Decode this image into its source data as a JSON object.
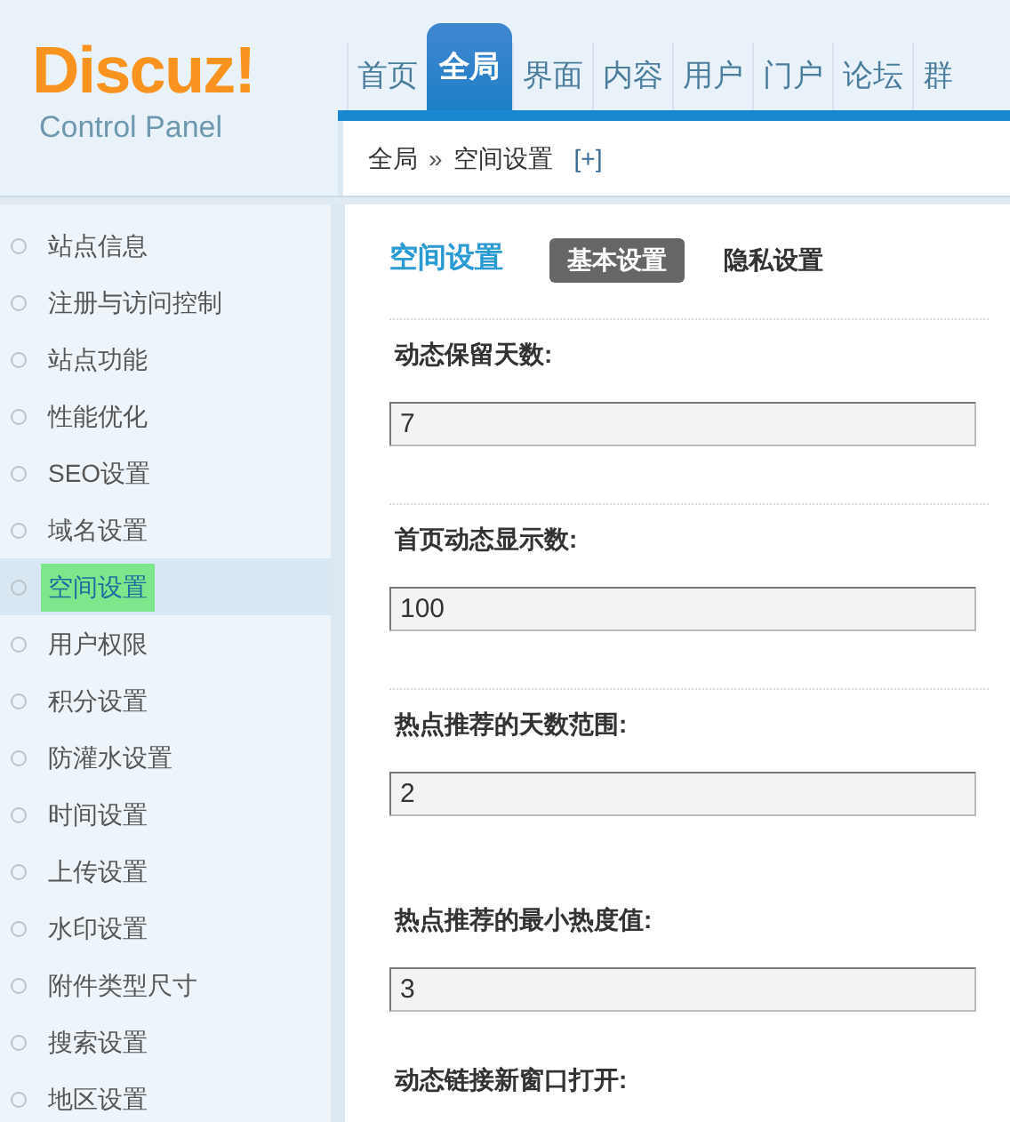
{
  "logo": {
    "brand": "Discuz!",
    "subtitle": "Control Panel"
  },
  "nav": [
    {
      "label": "首页",
      "selected": false
    },
    {
      "label": "全局",
      "selected": true
    },
    {
      "label": "界面",
      "selected": false
    },
    {
      "label": "内容",
      "selected": false
    },
    {
      "label": "用户",
      "selected": false
    },
    {
      "label": "门户",
      "selected": false
    },
    {
      "label": "论坛",
      "selected": false
    },
    {
      "label": "群",
      "selected": false
    }
  ],
  "breadcrumb": {
    "items": [
      "全局",
      "空间设置"
    ],
    "separator": "»",
    "toggle": "[+]"
  },
  "sidebar": {
    "items": [
      {
        "label": "站点信息",
        "selected": false
      },
      {
        "label": "注册与访问控制",
        "selected": false
      },
      {
        "label": "站点功能",
        "selected": false
      },
      {
        "label": "性能优化",
        "selected": false
      },
      {
        "label": "SEO设置",
        "selected": false
      },
      {
        "label": "域名设置",
        "selected": false
      },
      {
        "label": "空间设置",
        "selected": true
      },
      {
        "label": "用户权限",
        "selected": false
      },
      {
        "label": "积分设置",
        "selected": false
      },
      {
        "label": "防灌水设置",
        "selected": false
      },
      {
        "label": "时间设置",
        "selected": false
      },
      {
        "label": "上传设置",
        "selected": false
      },
      {
        "label": "水印设置",
        "selected": false
      },
      {
        "label": "附件类型尺寸",
        "selected": false
      },
      {
        "label": "搜索设置",
        "selected": false
      },
      {
        "label": "地区设置",
        "selected": false
      }
    ]
  },
  "main": {
    "title": "空间设置",
    "tabs": [
      {
        "label": "基本设置",
        "selected": true
      },
      {
        "label": "隐私设置",
        "selected": false
      }
    ],
    "fields": [
      {
        "label": "动态保留天数:",
        "value": "7",
        "divider": true
      },
      {
        "label": "首页动态显示数:",
        "value": "100",
        "divider": true
      },
      {
        "label": "热点推荐的天数范围:",
        "value": "2",
        "divider": true
      },
      {
        "label": "热点推荐的最小热度值:",
        "value": "3",
        "divider": false
      },
      {
        "label": "动态链接新窗口打开:",
        "divider": false
      }
    ]
  }
}
